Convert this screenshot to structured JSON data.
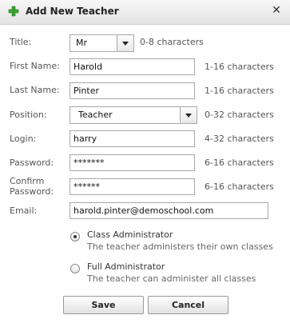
{
  "dialog": {
    "title": "Add New Teacher",
    "title_icon": "plus-icon",
    "close_glyph": "✕",
    "accent_color": "#3aa335"
  },
  "form": {
    "title": {
      "label": "Title:",
      "value": "Mr",
      "hint": "0-8 characters"
    },
    "first_name": {
      "label": "First Name:",
      "value": "Harold",
      "hint": "1-16 characters"
    },
    "last_name": {
      "label": "Last Name:",
      "value": "Pinter",
      "hint": "1-16 characters"
    },
    "position": {
      "label": "Position:",
      "value": "Teacher",
      "hint": "0-32 characters"
    },
    "login": {
      "label": "Login:",
      "value": "harry",
      "hint": "4-32 characters"
    },
    "password": {
      "label": "Password:",
      "value": "*******",
      "hint": "6-16 characters"
    },
    "confirm_password": {
      "label_line1": "Confirm",
      "label_line2": "Password:",
      "value": "******",
      "hint": "6-16 characters"
    },
    "email": {
      "label": "Email:",
      "value": "harold.pinter@demoschool.com"
    }
  },
  "role": {
    "options": [
      {
        "title": "Class Administrator",
        "description": "The teacher administers their own classes",
        "selected": true
      },
      {
        "title": "Full Administrator",
        "description": "The teacher can administer all classes",
        "selected": false
      }
    ]
  },
  "buttons": {
    "save": "Save",
    "cancel": "Cancel"
  }
}
